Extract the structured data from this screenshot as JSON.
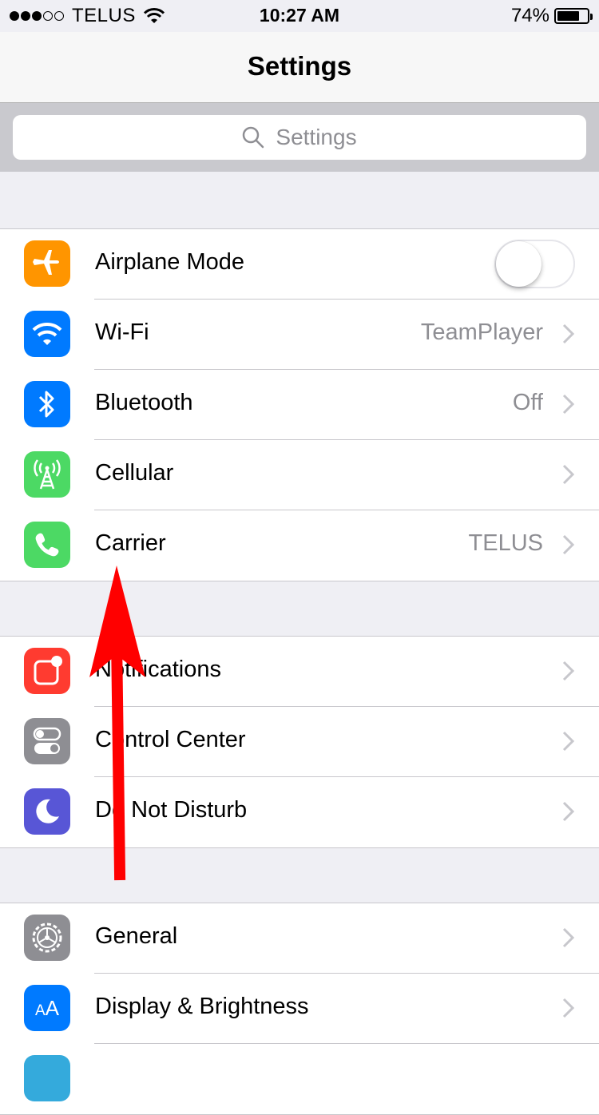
{
  "status_bar": {
    "carrier": "TELUS",
    "signal_full": 3,
    "signal_total": 5,
    "time": "10:27 AM",
    "battery_pct": "74%",
    "battery_level": 0.74
  },
  "nav": {
    "title": "Settings"
  },
  "search": {
    "placeholder": "Settings"
  },
  "groups": [
    {
      "rows": [
        {
          "label": "Airplane Mode",
          "icon": "airplane-icon",
          "icon_bg": "#ff9500",
          "toggle": false
        },
        {
          "label": "Wi-Fi",
          "value": "TeamPlayer",
          "icon": "wifi-icon",
          "icon_bg": "#007aff"
        },
        {
          "label": "Bluetooth",
          "value": "Off",
          "icon": "bluetooth-icon",
          "icon_bg": "#007aff"
        },
        {
          "label": "Cellular",
          "value": "",
          "icon": "cellular-antenna-icon",
          "icon_bg": "#4cd964"
        },
        {
          "label": "Carrier",
          "value": "TELUS",
          "icon": "phone-icon",
          "icon_bg": "#4cd964"
        }
      ]
    },
    {
      "rows": [
        {
          "label": "Notifications",
          "icon": "notifications-icon",
          "icon_bg": "#ff3b30"
        },
        {
          "label": "Control Center",
          "icon": "control-center-icon",
          "icon_bg": "#8e8e93"
        },
        {
          "label": "Do Not Disturb",
          "icon": "moon-icon",
          "icon_bg": "#5856d6"
        }
      ]
    },
    {
      "rows": [
        {
          "label": "General",
          "icon": "gear-icon",
          "icon_bg": "#8e8e93"
        },
        {
          "label": "Display & Brightness",
          "icon": "text-size-icon",
          "icon_bg": "#007aff",
          "icon_text": "AA"
        },
        {
          "label": "",
          "icon": "wallpaper-icon",
          "icon_bg": "#34aadc"
        }
      ]
    }
  ],
  "annotation": {
    "arrow_color": "#ff0000"
  }
}
